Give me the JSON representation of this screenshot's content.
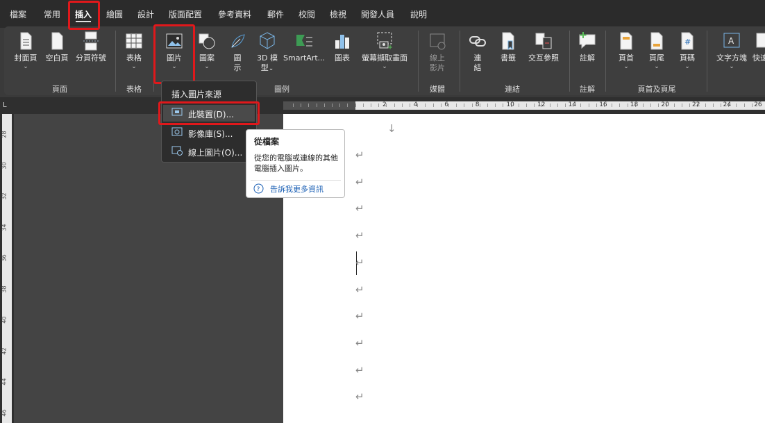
{
  "tabs": [
    "檔案",
    "常用",
    "插入",
    "繪圖",
    "設計",
    "版面配置",
    "參考資料",
    "郵件",
    "校閱",
    "檢視",
    "開發人員",
    "說明"
  ],
  "active_tab": "插入",
  "ribbon": {
    "buttons": {
      "cover": "封面頁",
      "blank": "空白頁",
      "pagebreak": "分頁符號",
      "table": "表格",
      "pictures": "圖片",
      "shapes": "圖案",
      "icons_l1": "圖",
      "icons_l2": "示",
      "model3d_l1": "3D 模",
      "model3d_l2": "型",
      "smartart": "SmartArt...",
      "chart": "圖表",
      "screenshot": "螢幕擷取畫面",
      "online_video_l1": "線上",
      "online_video_l2": "影片",
      "link_l1": "連",
      "link_l2": "結",
      "bookmark": "書籤",
      "crossref": "交互參照",
      "comment": "註解",
      "header": "頁首",
      "footer": "頁尾",
      "pagenum": "頁碼",
      "textbox": "文字方塊",
      "quickparts": "快速"
    },
    "groups": {
      "pages": "頁面",
      "tables": "表格",
      "illustrations": "圖例",
      "media": "媒體",
      "links": "連結",
      "comments": "註解",
      "header_footer": "頁首及頁尾"
    }
  },
  "ruler": {
    "h_numbers": [
      "2",
      "4",
      "6",
      "8",
      "10",
      "12",
      "14",
      "16",
      "18",
      "20",
      "22",
      "24",
      "26"
    ],
    "v_numbers": [
      "28",
      "30",
      "32",
      "34",
      "36",
      "38",
      "40",
      "42",
      "44",
      "46"
    ],
    "corner": "L"
  },
  "menu": {
    "title": "插入圖片來源",
    "items": [
      "此裝置(D)...",
      "影像庫(S)...",
      "線上圖片(O)..."
    ]
  },
  "tooltip": {
    "title": "從檔案",
    "body": "從您的電腦或連線的其他電腦插入圖片。",
    "link": "告訴我更多資訊"
  },
  "document": {
    "arrow_mark": "↓",
    "para_mark": "↵"
  },
  "colors": {
    "highlight": "#e0181b",
    "link": "#1a5fb4"
  }
}
